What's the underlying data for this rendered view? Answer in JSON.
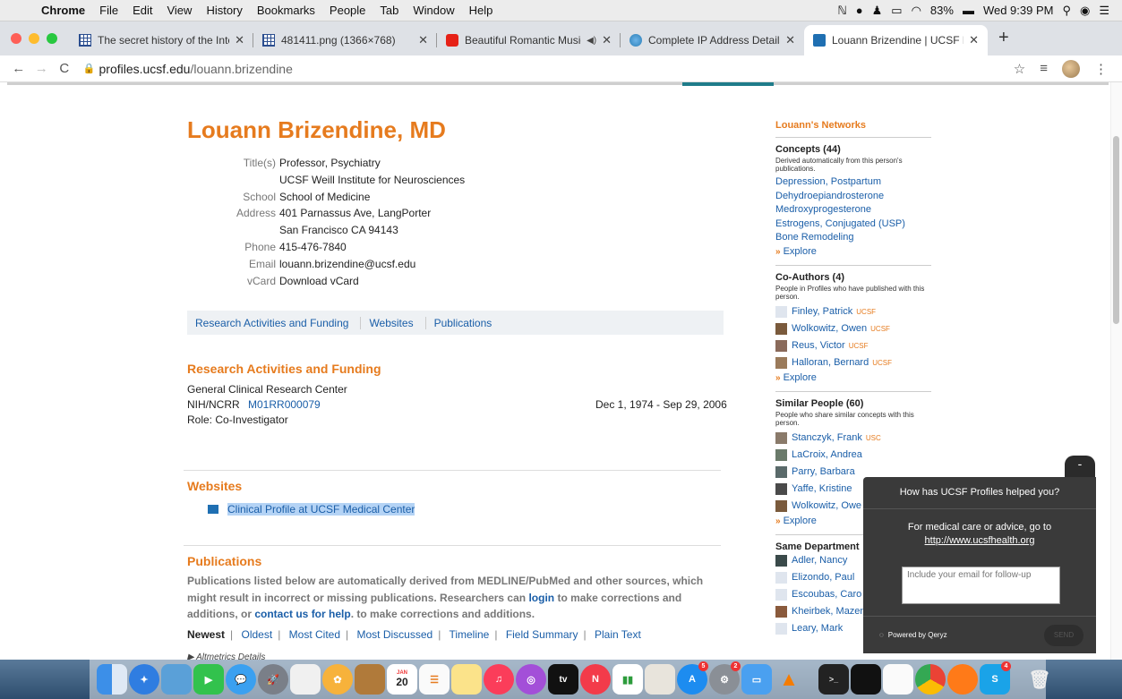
{
  "menubar": {
    "app": "Chrome",
    "items": [
      "File",
      "Edit",
      "View",
      "History",
      "Bookmarks",
      "People",
      "Tab",
      "Window",
      "Help"
    ],
    "battery": "83%",
    "clock": "Wed 9:39 PM"
  },
  "tabs": [
    {
      "label": "The secret history of the Intern",
      "icon": "grid-icon",
      "active": false
    },
    {
      "label": "481411.png (1366×768)",
      "icon": "grid-icon",
      "active": false
    },
    {
      "label": "Beautiful Romantic Music: ",
      "icon": "youtube-icon",
      "active": false
    },
    {
      "label": "Complete IP Address Details fo",
      "icon": "globe-icon",
      "active": false
    },
    {
      "label": "Louann Brizendine | UCSF Prof",
      "icon": "ucsf-icon",
      "active": true
    }
  ],
  "address": {
    "host": "profiles.ucsf.edu",
    "path": "/louann.brizendine"
  },
  "profile": {
    "name": "Louann Brizendine, MD",
    "fields": [
      {
        "label": "Title(s)",
        "value": "Professor, Psychiatry"
      },
      {
        "label": "",
        "value": "UCSF Weill Institute for Neurosciences"
      },
      {
        "label": "School",
        "value": "School of Medicine"
      },
      {
        "label": "Address",
        "value": "401 Parnassus Ave, LangPorter"
      },
      {
        "label": "",
        "value": "San Francisco CA 94143"
      },
      {
        "label": "Phone",
        "value": "415-476-7840"
      },
      {
        "label": "Email",
        "value": "louann.brizendine@ucsf.edu"
      },
      {
        "label": "vCard",
        "value": "Download vCard"
      }
    ]
  },
  "subnav": [
    "Research Activities and Funding",
    "Websites",
    "Publications"
  ],
  "research": {
    "heading": "Research Activities and Funding",
    "center": "General Clinical Research Center",
    "org": "NIH/NCRR",
    "grant": "M01RR000079",
    "dates": "Dec 1, 1974 - Sep 29, 2006",
    "role": "Role: Co-Investigator"
  },
  "websites": {
    "heading": "Websites",
    "link": "Clinical Profile at UCSF Medical Center"
  },
  "publications": {
    "heading": "Publications",
    "desc_part1": "Publications listed below are automatically derived from MEDLINE/PubMed and other sources, which might result in incorrect or missing publications. Researchers can ",
    "login": "login",
    "desc_part2": " to make corrections and additions, or ",
    "contact": "contact us for help",
    "desc_part3": ". to make corrections and additions.",
    "sorts": [
      "Newest",
      "Oldest",
      "Most Cited",
      "Most Discussed",
      "Timeline",
      "Field Summary",
      "Plain Text"
    ],
    "altmetrics": "Altmetrics Details"
  },
  "sidebar": {
    "title": "Louann's Networks",
    "concepts": {
      "heading": "Concepts (44)",
      "desc": "Derived automatically from this person's publications.",
      "items": [
        "Depression, Postpartum",
        "Dehydroepiandrosterone",
        "Medroxyprogesterone",
        "Estrogens, Conjugated (USP)",
        "Bone Remodeling"
      ]
    },
    "coauthors": {
      "heading": "Co-Authors (4)",
      "desc": "People in Profiles who have published with this person.",
      "items": [
        {
          "name": "Finley, Patrick",
          "inst": "UCSF"
        },
        {
          "name": "Wolkowitz, Owen",
          "inst": "UCSF"
        },
        {
          "name": "Reus, Victor",
          "inst": "UCSF"
        },
        {
          "name": "Halloran, Bernard",
          "inst": "UCSF"
        }
      ]
    },
    "similar": {
      "heading": "Similar People (60)",
      "desc": "People who share similar concepts with this person.",
      "items": [
        {
          "name": "Stanczyk, Frank",
          "inst": "USC"
        },
        {
          "name": "LaCroix, Andrea",
          "inst": ""
        },
        {
          "name": "Parry, Barbara",
          "inst": ""
        },
        {
          "name": "Yaffe, Kristine",
          "inst": ""
        },
        {
          "name": "Wolkowitz, Owe",
          "inst": ""
        }
      ]
    },
    "department": {
      "heading": "Same Department",
      "items": [
        "Adler, Nancy",
        "Elizondo, Paul",
        "Escoubas, Caro",
        "Kheirbek, Mazen",
        "Leary, Mark"
      ]
    },
    "explore": "Explore"
  },
  "feedback": {
    "question": "How has UCSF Profiles helped you?",
    "medical": "For medical care or advice, go to",
    "medical_link": "http://www.ucsfhealth.org",
    "placeholder": "Include your email for follow-up",
    "powered": "Powered by Qeryz",
    "send": "SEND"
  },
  "dock": {
    "calendar_day": "20",
    "calendar_month": "JAN",
    "tv_label": "tv"
  }
}
